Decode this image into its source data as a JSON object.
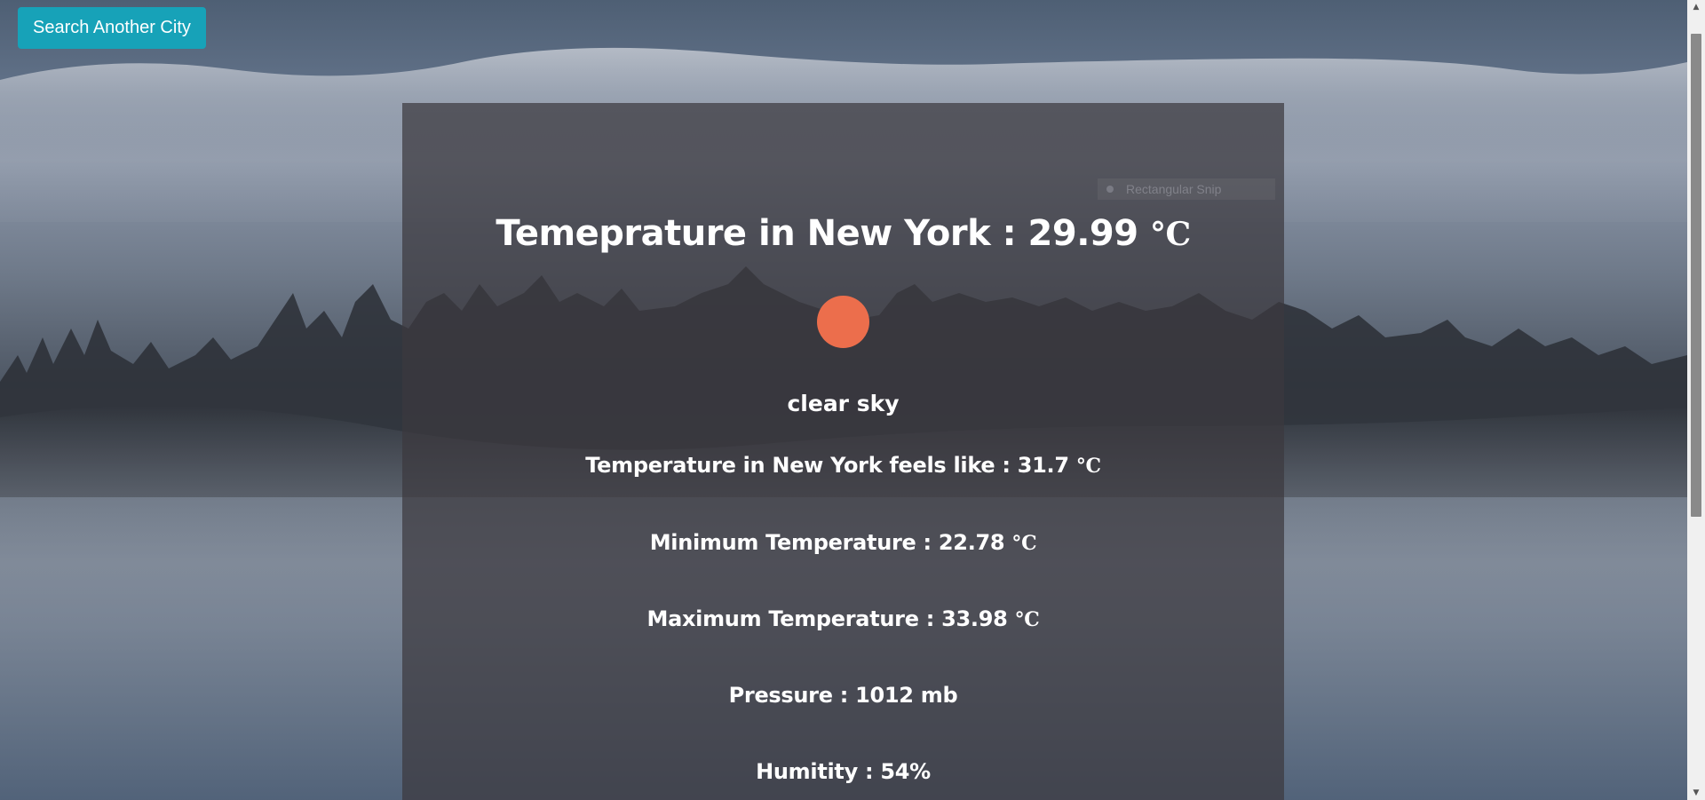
{
  "header": {
    "search_button_label": "Search Another City"
  },
  "snip_overlay": {
    "label": "Rectangular Snip"
  },
  "weather": {
    "title_prefix": "Temeprature in New York : 29.99 ",
    "title_unit": "°C",
    "icon": "sun-icon",
    "icon_color": "#ec6e4c",
    "description": "clear sky",
    "feels_like_text": "Temperature in New York feels like : 31.7 ",
    "feels_like_unit": "°C",
    "min_text": "Minimum Temperature : 22.78 ",
    "min_unit": "°C",
    "max_text": "Maximum Temperature : 33.98 ",
    "max_unit": "°C",
    "pressure_text": "Pressure : 1012 mb",
    "humidity_text": "Humitity : 54%"
  },
  "colors": {
    "button": "#17a2b8",
    "card": "rgba(60,57,62,0.72)",
    "text": "#ffffff"
  }
}
